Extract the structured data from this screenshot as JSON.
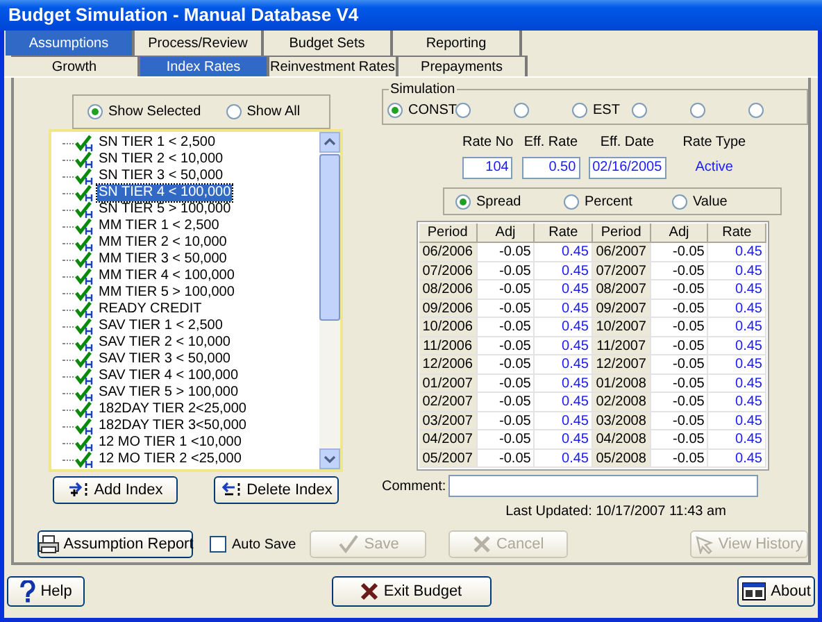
{
  "window": {
    "title": "Budget Simulation - Manual Database V4"
  },
  "tabs": [
    {
      "label": "Assumptions",
      "selected": true
    },
    {
      "label": "Process/Review",
      "selected": false
    },
    {
      "label": "Budget Sets",
      "selected": false
    },
    {
      "label": "Reporting",
      "selected": false
    }
  ],
  "subtabs": [
    {
      "label": "Growth",
      "selected": false
    },
    {
      "label": "Index Rates",
      "selected": true
    },
    {
      "label": "Reinvestment Rates",
      "selected": false
    },
    {
      "label": "Prepayments",
      "selected": false
    }
  ],
  "show_filter": [
    {
      "label": "Show Selected",
      "selected": true
    },
    {
      "label": "Show All",
      "selected": false
    }
  ],
  "index_list": [
    {
      "label": "SN TIER 1 < 2,500",
      "selected": false
    },
    {
      "label": "SN TIER 2 < 10,000",
      "selected": false
    },
    {
      "label": "SN TIER 3 < 50,000",
      "selected": false
    },
    {
      "label": "SN TIER 4 < 100,000",
      "selected": true
    },
    {
      "label": "SN TIER 5 > 100,000",
      "selected": false
    },
    {
      "label": "MM TIER 1 < 2,500",
      "selected": false
    },
    {
      "label": "MM TIER 2 < 10,000",
      "selected": false
    },
    {
      "label": "MM TIER 3 < 50,000",
      "selected": false
    },
    {
      "label": "MM TIER 4 < 100,000",
      "selected": false
    },
    {
      "label": "MM TIER 5 > 100,000",
      "selected": false
    },
    {
      "label": "READY CREDIT",
      "selected": false
    },
    {
      "label": "SAV TIER 1 < 2,500",
      "selected": false
    },
    {
      "label": "SAV TIER 2 < 10,000",
      "selected": false
    },
    {
      "label": "SAV TIER 3 < 50,000",
      "selected": false
    },
    {
      "label": "SAV TIER 4 < 100,000",
      "selected": false
    },
    {
      "label": "SAV TIER 5 > 100,000",
      "selected": false
    },
    {
      "label": "182DAY TIER 2<25,000",
      "selected": false
    },
    {
      "label": "182DAY TIER 3<50,000",
      "selected": false
    },
    {
      "label": "12 MO TIER 1 <10,000",
      "selected": false
    },
    {
      "label": "12 MO TIER 2 <25,000",
      "selected": false
    }
  ],
  "list_buttons": [
    {
      "label": "Add Index",
      "kind": "add"
    },
    {
      "label": "Delete Index",
      "kind": "delete"
    }
  ],
  "simulation": {
    "title": "Simulation",
    "options": [
      {
        "label": "CONST",
        "selected": true
      },
      {
        "selected": false
      },
      {
        "selected": false
      },
      {
        "label": "EST",
        "selected": false
      },
      {
        "selected": false
      },
      {
        "selected": false
      },
      {
        "selected": false
      }
    ]
  },
  "rate_fields": [
    {
      "label": "Rate No",
      "value": "104"
    },
    {
      "label": "Eff. Rate",
      "value": "0.50"
    },
    {
      "label": "Eff. Date",
      "value": "02/16/2005"
    }
  ],
  "rate_type": {
    "label": "Rate Type",
    "value": "Active"
  },
  "adjust_mode": [
    {
      "label": "Spread",
      "selected": true
    },
    {
      "label": "Percent",
      "selected": false
    },
    {
      "label": "Value",
      "selected": false
    }
  ],
  "table": {
    "columns": [
      {
        "label": "Period",
        "kind": "period"
      },
      {
        "label": "Adj",
        "kind": "adj"
      },
      {
        "label": "Rate",
        "kind": "rate"
      },
      {
        "label": "Period",
        "kind": "period"
      },
      {
        "label": "Adj",
        "kind": "adj"
      },
      {
        "label": "Rate",
        "kind": "rate"
      }
    ],
    "rows": [
      [
        "06/2006",
        "-0.05",
        "0.45",
        "06/2007",
        "-0.05",
        "0.45"
      ],
      [
        "07/2006",
        "-0.05",
        "0.45",
        "07/2007",
        "-0.05",
        "0.45"
      ],
      [
        "08/2006",
        "-0.05",
        "0.45",
        "08/2007",
        "-0.05",
        "0.45"
      ],
      [
        "09/2006",
        "-0.05",
        "0.45",
        "09/2007",
        "-0.05",
        "0.45"
      ],
      [
        "10/2006",
        "-0.05",
        "0.45",
        "10/2007",
        "-0.05",
        "0.45"
      ],
      [
        "11/2006",
        "-0.05",
        "0.45",
        "11/2007",
        "-0.05",
        "0.45"
      ],
      [
        "12/2006",
        "-0.05",
        "0.45",
        "12/2007",
        "-0.05",
        "0.45"
      ],
      [
        "01/2007",
        "-0.05",
        "0.45",
        "01/2008",
        "-0.05",
        "0.45"
      ],
      [
        "02/2007",
        "-0.05",
        "0.45",
        "02/2008",
        "-0.05",
        "0.45"
      ],
      [
        "03/2007",
        "-0.05",
        "0.45",
        "03/2008",
        "-0.05",
        "0.45"
      ],
      [
        "04/2007",
        "-0.05",
        "0.45",
        "04/2008",
        "-0.05",
        "0.45"
      ],
      [
        "05/2007",
        "-0.05",
        "0.45",
        "05/2008",
        "-0.05",
        "0.45"
      ]
    ]
  },
  "comment": {
    "label": "Comment:"
  },
  "last_updated": "Last Updated: 10/17/2007 11:43 am",
  "actions": [
    {
      "kind": "report",
      "label": "Assumption Report",
      "disabled": false
    },
    {
      "kind": "checkbox",
      "label": "Auto Save",
      "checked": false
    },
    {
      "kind": "save",
      "label": "Save",
      "disabled": true
    },
    {
      "kind": "cancel",
      "label": "Cancel",
      "disabled": true
    },
    {
      "kind": "history",
      "label": "View History",
      "disabled": true
    }
  ],
  "footer": [
    {
      "kind": "help",
      "label": "Help"
    },
    {
      "kind": "exit",
      "label": "Exit Budget"
    },
    {
      "kind": "about",
      "label": "About"
    }
  ]
}
